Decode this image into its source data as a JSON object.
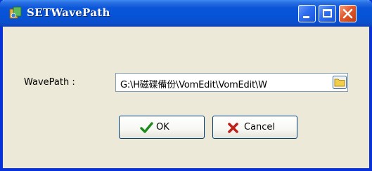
{
  "window": {
    "title": "SETWavePath",
    "app_icon": "app-icon",
    "buttons": {
      "minimize": "minimize-icon",
      "maximize": "maximize-icon",
      "close": "close-icon"
    }
  },
  "form": {
    "path_label": "WavePath :",
    "path_value": "G:\\H磁碟備份\\VomEdit\\VomEdit\\W",
    "browse_icon": "folder-icon"
  },
  "actions": {
    "ok_label": "OK",
    "ok_icon": "check-icon",
    "cancel_label": "Cancel",
    "cancel_icon": "x-icon"
  },
  "colors": {
    "titlebar": "#0a55d8",
    "frame": "#0831d9",
    "client_bg": "#ece9d8",
    "close_button": "#e2572d",
    "ok_check": "#1c8a1c",
    "cancel_x": "#c0201a"
  }
}
